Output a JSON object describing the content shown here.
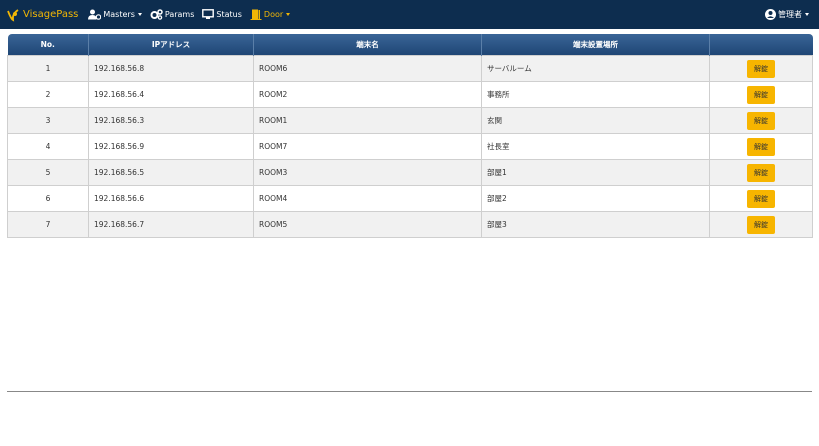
{
  "navbar": {
    "brand": "VisagePass",
    "items": [
      {
        "label": "Masters",
        "icon": "users-cog-icon",
        "has_dropdown": true
      },
      {
        "label": "Params",
        "icon": "cogs-icon",
        "has_dropdown": false
      },
      {
        "label": "Status",
        "icon": "monitor-icon",
        "has_dropdown": false
      },
      {
        "label": "Door",
        "icon": "door-icon",
        "has_dropdown": true
      }
    ],
    "user_label": "管理者",
    "colors": {
      "background": "#0d2d4f",
      "accent": "#f2b705"
    }
  },
  "table": {
    "headers": [
      "No.",
      "IPアドレス",
      "端末名",
      "端末設置場所",
      ""
    ],
    "rows": [
      {
        "no": "1",
        "ip": "192.168.56.8",
        "name": "ROOM6",
        "location": "サーバルーム",
        "action": "解錠"
      },
      {
        "no": "2",
        "ip": "192.168.56.4",
        "name": "ROOM2",
        "location": "事務所",
        "action": "解錠"
      },
      {
        "no": "3",
        "ip": "192.168.56.3",
        "name": "ROOM1",
        "location": "玄関",
        "action": "解錠"
      },
      {
        "no": "4",
        "ip": "192.168.56.9",
        "name": "ROOM7",
        "location": "社長室",
        "action": "解錠"
      },
      {
        "no": "5",
        "ip": "192.168.56.5",
        "name": "ROOM3",
        "location": "部屋1",
        "action": "解錠"
      },
      {
        "no": "6",
        "ip": "192.168.56.6",
        "name": "ROOM4",
        "location": "部屋2",
        "action": "解錠"
      },
      {
        "no": "7",
        "ip": "192.168.56.7",
        "name": "ROOM5",
        "location": "部屋3",
        "action": "解錠"
      }
    ],
    "colors": {
      "header": "#2a5283",
      "button": "#f7b500"
    }
  }
}
